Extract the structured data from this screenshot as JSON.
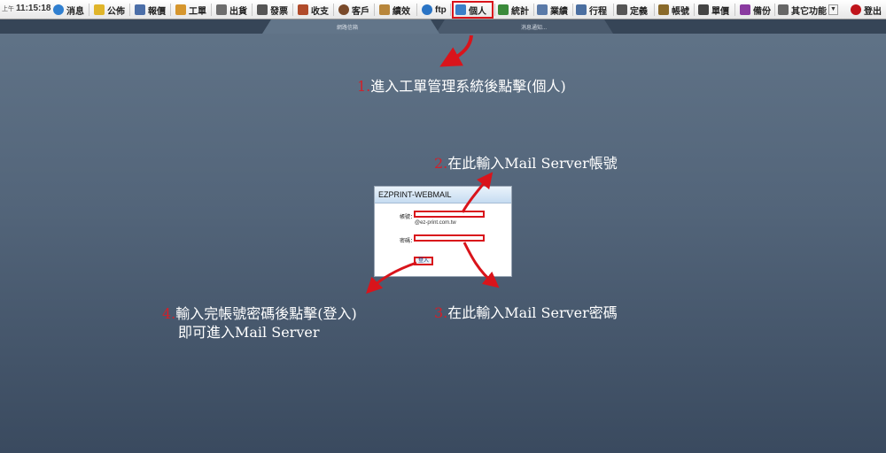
{
  "clock": {
    "ampm": "上午",
    "time": "11:15:18"
  },
  "toolbar": {
    "items": [
      {
        "label": "消息",
        "icon": "chat-bubble-icon",
        "color": "#2f7fd0"
      },
      {
        "label": "公佈",
        "icon": "notepad-icon",
        "color": "#e0b52a"
      },
      {
        "label": "報價",
        "icon": "table-icon",
        "color": "#4b6ea8"
      },
      {
        "label": "工單",
        "icon": "pencil-icon",
        "color": "#d6962d"
      },
      {
        "label": "出貨",
        "icon": "printer-icon",
        "color": "#6d6d6d"
      },
      {
        "label": "發票",
        "icon": "invoice-icon",
        "color": "#555555"
      },
      {
        "label": "收支",
        "icon": "book-icon",
        "color": "#b04a2a"
      },
      {
        "label": "客戶",
        "icon": "person-icon",
        "color": "#7a4a2a"
      },
      {
        "label": "績效",
        "icon": "handshake-icon",
        "color": "#b8863b"
      },
      {
        "label": "ftp",
        "icon": "ftp-icon",
        "color": "#2a74c5"
      },
      {
        "label": "個人",
        "icon": "mail-icon",
        "color": "#3a7fc8"
      },
      {
        "label": "統計",
        "icon": "bar-chart-icon",
        "color": "#3a8a3a"
      },
      {
        "label": "業績",
        "icon": "list-icon",
        "color": "#5a7aa8"
      },
      {
        "label": "行程",
        "icon": "calendar-icon",
        "color": "#4a6ea0"
      },
      {
        "label": "定義",
        "icon": "gear-doc-icon",
        "color": "#555555"
      },
      {
        "label": "帳號",
        "icon": "lock-icon",
        "color": "#8a6a2a"
      },
      {
        "label": "單價",
        "icon": "price-tag-icon",
        "color": "#444444"
      },
      {
        "label": "備份",
        "icon": "books-icon",
        "color": "#8a3aa0"
      },
      {
        "label": "其它功能",
        "icon": "list-box-icon",
        "color": "#666666"
      },
      {
        "label": "登出",
        "icon": "power-icon",
        "color": "#c0141b"
      }
    ]
  },
  "tabs": [
    {
      "label": "網路信箱"
    },
    {
      "label": "消息通知..."
    }
  ],
  "annotations": {
    "step1": {
      "num": "1.",
      "text": "進入工單管理系統後點擊(個人)"
    },
    "step2": {
      "num": "2.",
      "text": "在此輸入Mail Server帳號"
    },
    "step3": {
      "num": "3.",
      "text": "在此輸入Mail Server密碼"
    },
    "step4": {
      "num": "4.",
      "line1": "輸入完帳號密碼後點擊(登入)",
      "line2": "即可進入Mail Server"
    }
  },
  "login": {
    "title": "EZPRINT-WEBMAIL",
    "account_label": "帳號：",
    "account_value": "",
    "domain_hint": "@ez-print.com.tw",
    "password_label": "密碼：",
    "password_value": "",
    "login_button": "登入"
  },
  "colors": {
    "highlight": "#d9141b",
    "annotation_number": "#d1202a",
    "background": "#53657a"
  }
}
